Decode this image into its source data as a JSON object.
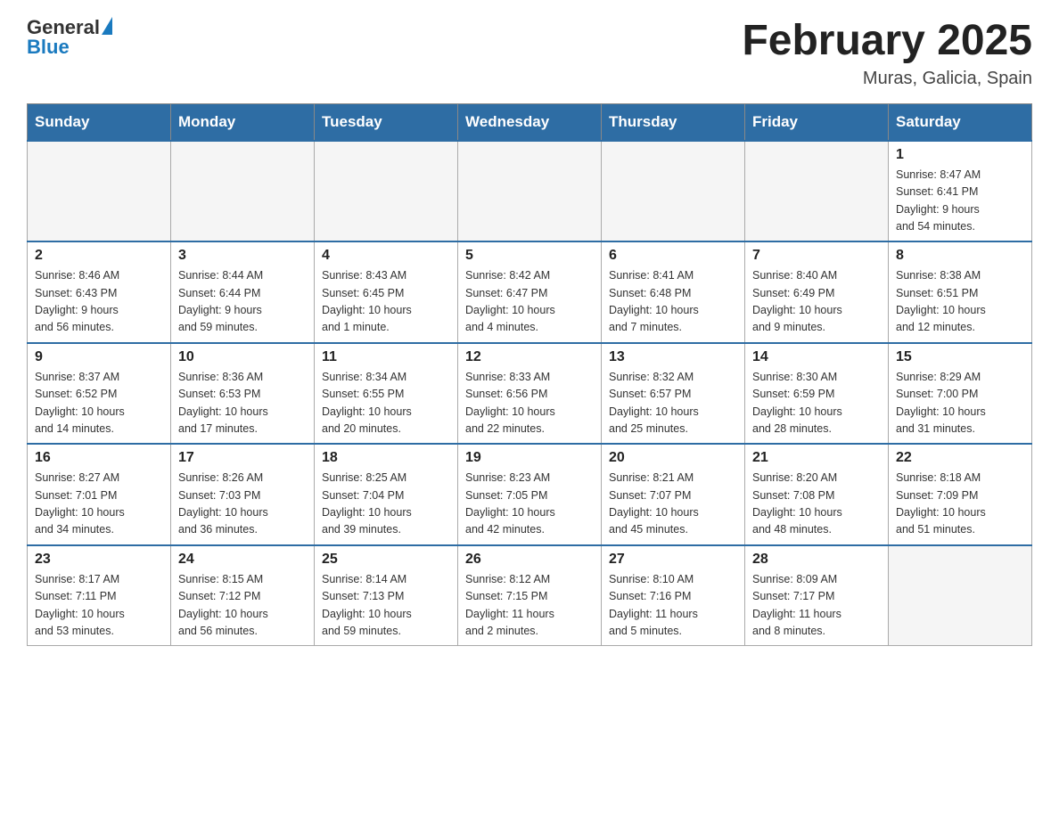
{
  "header": {
    "title": "February 2025",
    "subtitle": "Muras, Galicia, Spain",
    "logo_general": "General",
    "logo_blue": "Blue"
  },
  "weekdays": [
    "Sunday",
    "Monday",
    "Tuesday",
    "Wednesday",
    "Thursday",
    "Friday",
    "Saturday"
  ],
  "weeks": [
    [
      {
        "day": "",
        "info": ""
      },
      {
        "day": "",
        "info": ""
      },
      {
        "day": "",
        "info": ""
      },
      {
        "day": "",
        "info": ""
      },
      {
        "day": "",
        "info": ""
      },
      {
        "day": "",
        "info": ""
      },
      {
        "day": "1",
        "info": "Sunrise: 8:47 AM\nSunset: 6:41 PM\nDaylight: 9 hours\nand 54 minutes."
      }
    ],
    [
      {
        "day": "2",
        "info": "Sunrise: 8:46 AM\nSunset: 6:43 PM\nDaylight: 9 hours\nand 56 minutes."
      },
      {
        "day": "3",
        "info": "Sunrise: 8:44 AM\nSunset: 6:44 PM\nDaylight: 9 hours\nand 59 minutes."
      },
      {
        "day": "4",
        "info": "Sunrise: 8:43 AM\nSunset: 6:45 PM\nDaylight: 10 hours\nand 1 minute."
      },
      {
        "day": "5",
        "info": "Sunrise: 8:42 AM\nSunset: 6:47 PM\nDaylight: 10 hours\nand 4 minutes."
      },
      {
        "day": "6",
        "info": "Sunrise: 8:41 AM\nSunset: 6:48 PM\nDaylight: 10 hours\nand 7 minutes."
      },
      {
        "day": "7",
        "info": "Sunrise: 8:40 AM\nSunset: 6:49 PM\nDaylight: 10 hours\nand 9 minutes."
      },
      {
        "day": "8",
        "info": "Sunrise: 8:38 AM\nSunset: 6:51 PM\nDaylight: 10 hours\nand 12 minutes."
      }
    ],
    [
      {
        "day": "9",
        "info": "Sunrise: 8:37 AM\nSunset: 6:52 PM\nDaylight: 10 hours\nand 14 minutes."
      },
      {
        "day": "10",
        "info": "Sunrise: 8:36 AM\nSunset: 6:53 PM\nDaylight: 10 hours\nand 17 minutes."
      },
      {
        "day": "11",
        "info": "Sunrise: 8:34 AM\nSunset: 6:55 PM\nDaylight: 10 hours\nand 20 minutes."
      },
      {
        "day": "12",
        "info": "Sunrise: 8:33 AM\nSunset: 6:56 PM\nDaylight: 10 hours\nand 22 minutes."
      },
      {
        "day": "13",
        "info": "Sunrise: 8:32 AM\nSunset: 6:57 PM\nDaylight: 10 hours\nand 25 minutes."
      },
      {
        "day": "14",
        "info": "Sunrise: 8:30 AM\nSunset: 6:59 PM\nDaylight: 10 hours\nand 28 minutes."
      },
      {
        "day": "15",
        "info": "Sunrise: 8:29 AM\nSunset: 7:00 PM\nDaylight: 10 hours\nand 31 minutes."
      }
    ],
    [
      {
        "day": "16",
        "info": "Sunrise: 8:27 AM\nSunset: 7:01 PM\nDaylight: 10 hours\nand 34 minutes."
      },
      {
        "day": "17",
        "info": "Sunrise: 8:26 AM\nSunset: 7:03 PM\nDaylight: 10 hours\nand 36 minutes."
      },
      {
        "day": "18",
        "info": "Sunrise: 8:25 AM\nSunset: 7:04 PM\nDaylight: 10 hours\nand 39 minutes."
      },
      {
        "day": "19",
        "info": "Sunrise: 8:23 AM\nSunset: 7:05 PM\nDaylight: 10 hours\nand 42 minutes."
      },
      {
        "day": "20",
        "info": "Sunrise: 8:21 AM\nSunset: 7:07 PM\nDaylight: 10 hours\nand 45 minutes."
      },
      {
        "day": "21",
        "info": "Sunrise: 8:20 AM\nSunset: 7:08 PM\nDaylight: 10 hours\nand 48 minutes."
      },
      {
        "day": "22",
        "info": "Sunrise: 8:18 AM\nSunset: 7:09 PM\nDaylight: 10 hours\nand 51 minutes."
      }
    ],
    [
      {
        "day": "23",
        "info": "Sunrise: 8:17 AM\nSunset: 7:11 PM\nDaylight: 10 hours\nand 53 minutes."
      },
      {
        "day": "24",
        "info": "Sunrise: 8:15 AM\nSunset: 7:12 PM\nDaylight: 10 hours\nand 56 minutes."
      },
      {
        "day": "25",
        "info": "Sunrise: 8:14 AM\nSunset: 7:13 PM\nDaylight: 10 hours\nand 59 minutes."
      },
      {
        "day": "26",
        "info": "Sunrise: 8:12 AM\nSunset: 7:15 PM\nDaylight: 11 hours\nand 2 minutes."
      },
      {
        "day": "27",
        "info": "Sunrise: 8:10 AM\nSunset: 7:16 PM\nDaylight: 11 hours\nand 5 minutes."
      },
      {
        "day": "28",
        "info": "Sunrise: 8:09 AM\nSunset: 7:17 PM\nDaylight: 11 hours\nand 8 minutes."
      },
      {
        "day": "",
        "info": ""
      }
    ]
  ]
}
